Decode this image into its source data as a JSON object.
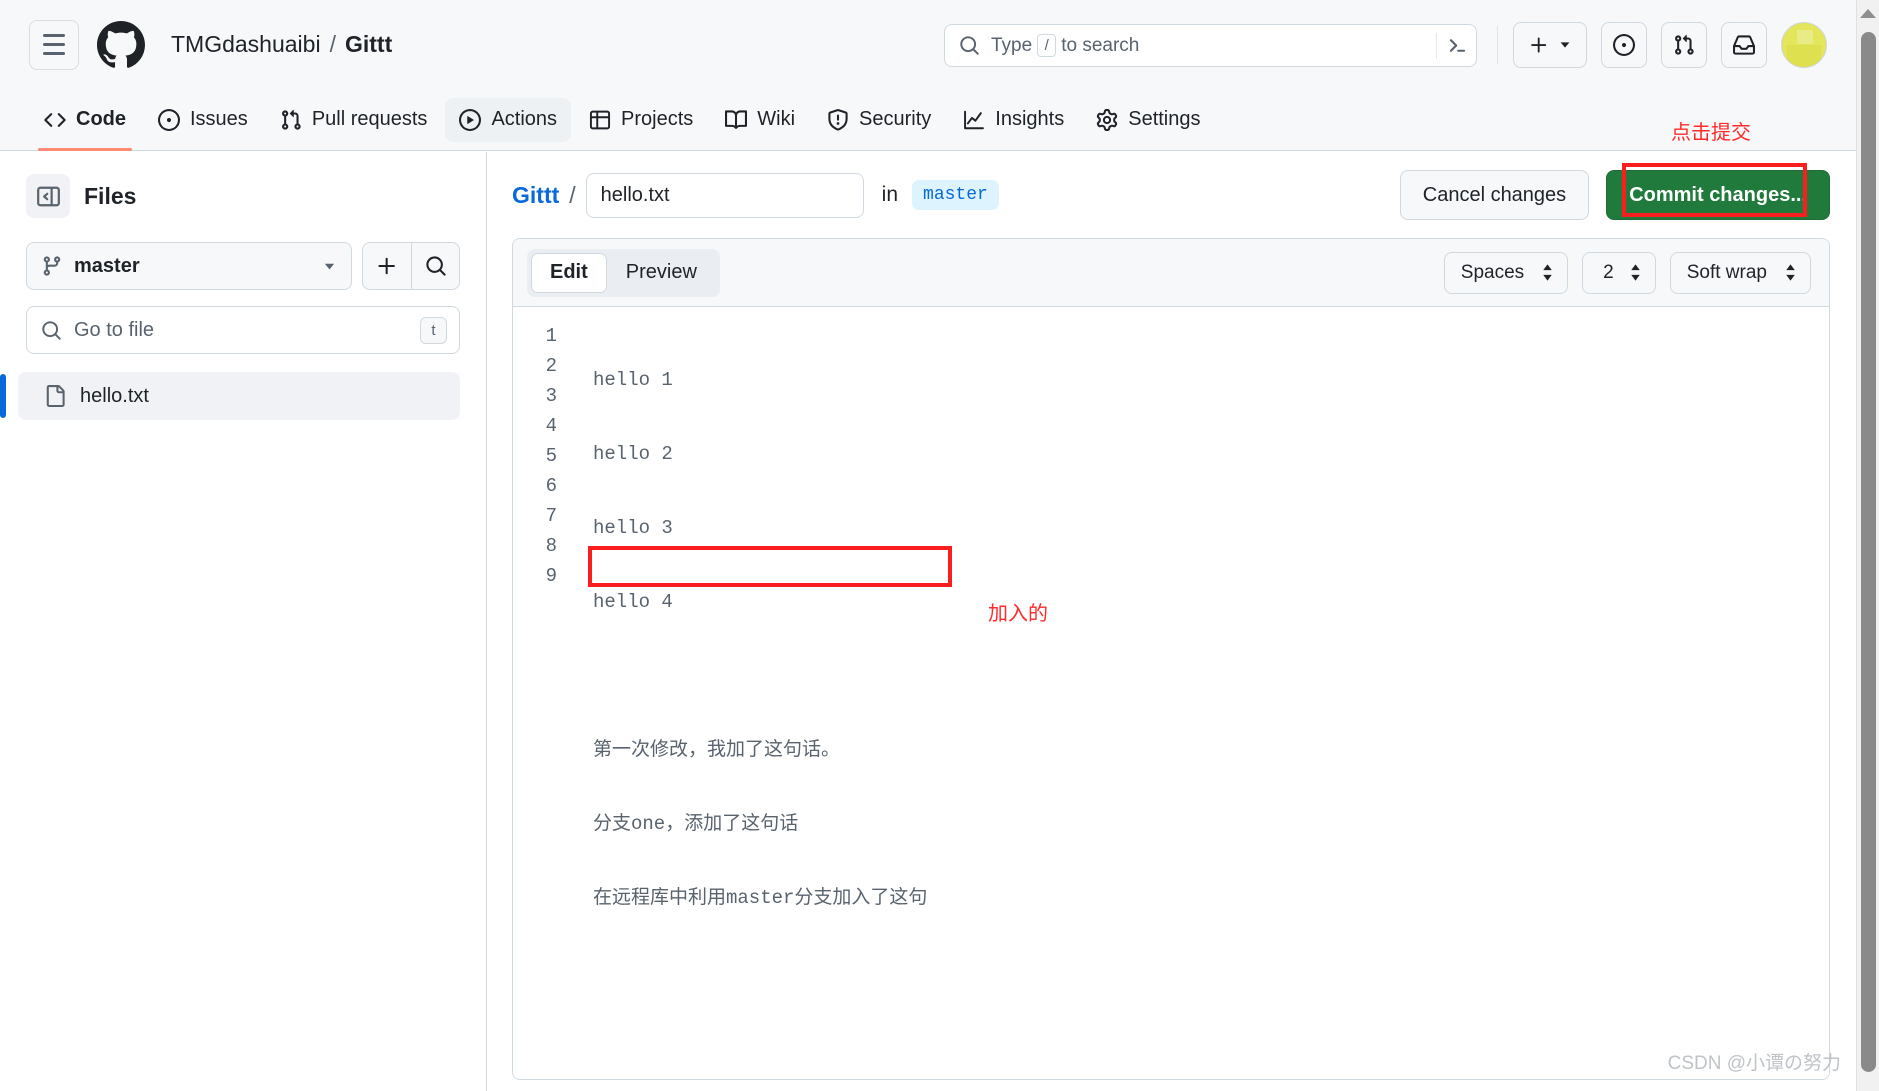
{
  "header": {
    "menu_icon": "hamburger-icon",
    "logo_icon": "github-logo-icon",
    "owner": "TMGdashuaibi",
    "separator": "/",
    "repo": "Gittt",
    "search": {
      "placeholder_prefix": "Type",
      "slash_key": "/",
      "placeholder_suffix": "to search",
      "icon": "search-icon",
      "terminal_icon": "command-palette-icon"
    },
    "actions": {
      "create_label": "+",
      "create_caret": "▾",
      "issues_icon": "circle-dot-icon",
      "pulls_icon": "git-pull-request-icon",
      "inbox_icon": "inbox-icon",
      "avatar": "user-avatar"
    }
  },
  "nav": {
    "items": [
      {
        "label": "Code",
        "icon": "code-icon",
        "state": "selected"
      },
      {
        "label": "Issues",
        "icon": "circle-dot-icon",
        "state": "normal"
      },
      {
        "label": "Pull requests",
        "icon": "git-pull-request-icon",
        "state": "normal"
      },
      {
        "label": "Actions",
        "icon": "play-icon",
        "state": "hover"
      },
      {
        "label": "Projects",
        "icon": "table-icon",
        "state": "normal"
      },
      {
        "label": "Wiki",
        "icon": "book-icon",
        "state": "normal"
      },
      {
        "label": "Security",
        "icon": "shield-icon",
        "state": "normal"
      },
      {
        "label": "Insights",
        "icon": "graph-icon",
        "state": "normal"
      },
      {
        "label": "Settings",
        "icon": "gear-icon",
        "state": "normal"
      }
    ]
  },
  "sidebar": {
    "toggle_icon": "sidebar-collapse-icon",
    "title": "Files",
    "branch": {
      "icon": "git-branch-icon",
      "name": "master",
      "caret": "▾"
    },
    "add_icon": "plus-icon",
    "search_icon": "search-icon",
    "gotofile": {
      "icon": "search-icon",
      "placeholder": "Go to file",
      "shortcut": "t"
    },
    "files": [
      {
        "name": "hello.txt",
        "icon": "file-icon",
        "selected": true
      }
    ]
  },
  "main": {
    "path": {
      "repo": "Gittt",
      "slash": "/",
      "filename_value": "hello.txt",
      "in_label": "in",
      "branch": "master"
    },
    "buttons": {
      "cancel": "Cancel changes",
      "commit": "Commit changes..."
    },
    "editor": {
      "tabs": [
        {
          "label": "Edit",
          "active": true
        },
        {
          "label": "Preview",
          "active": false
        }
      ],
      "settings": {
        "indent_mode": "Spaces",
        "indent_size": "2",
        "wrap_mode": "Soft wrap",
        "stepper_icon": "sort-arrows-icon"
      },
      "line_numbers": [
        "1",
        "2",
        "3",
        "4",
        "5",
        "6",
        "7",
        "8",
        "9"
      ],
      "lines": [
        "hello 1",
        "hello 2",
        "hello 3",
        "hello 4",
        "",
        "第一次修改，我加了这句话。",
        "分支one，添加了这句话",
        "在远程库中利用master分支加入了这句",
        ""
      ]
    }
  },
  "annotations": {
    "commit_label": "点击提交",
    "added_label": "加入的",
    "color": "#ff2b2b"
  },
  "watermark": "CSDN @小谭の努力",
  "colors": {
    "accent_blue": "#0969da",
    "commit_green": "#1f7a3c",
    "annotation_red": "#fa1e1e",
    "header_bg": "#f6f8fa",
    "border": "#d1d9e0"
  }
}
